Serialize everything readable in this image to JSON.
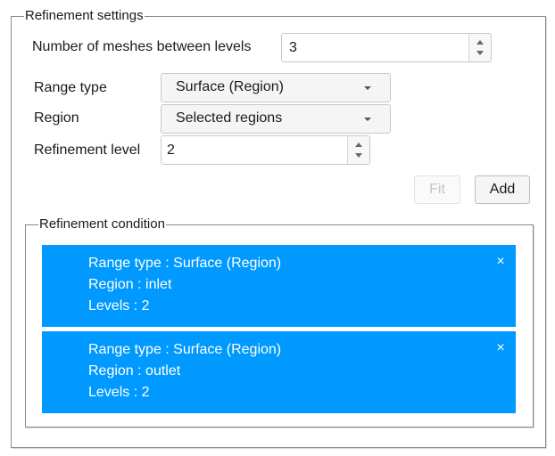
{
  "refinement_settings": {
    "legend": "Refinement settings",
    "meshes_between_levels": {
      "label": "Number of meshes between levels",
      "value": "3"
    },
    "range_type": {
      "label": "Range type",
      "value": "Surface (Region)"
    },
    "region": {
      "label": "Region",
      "value": "Selected regions"
    },
    "refinement_level": {
      "label": "Refinement level",
      "value": "2"
    },
    "buttons": {
      "fit": "Fit",
      "add": "Add"
    }
  },
  "refinement_condition": {
    "legend": "Refinement condition",
    "accent_color": "#0099ff",
    "items": [
      {
        "range_type": "Range type : Surface (Region)",
        "region": "Region : inlet",
        "levels": "Levels : 2",
        "close": "×"
      },
      {
        "range_type": "Range type : Surface (Region)",
        "region": "Region : outlet",
        "levels": "Levels : 2",
        "close": "×"
      }
    ]
  }
}
